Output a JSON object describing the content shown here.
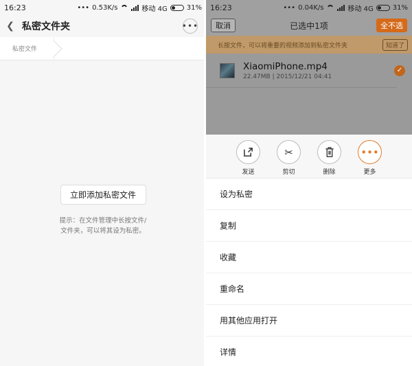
{
  "left": {
    "status": {
      "time": "16:23",
      "speed": "0.53K/s",
      "carrier": "移动 4G",
      "battery": "31%"
    },
    "header": {
      "title": "私密文件夹"
    },
    "breadcrumb": "私密文件",
    "add_button": "立即添加私密文件",
    "hint_line1": "提示：在文件管理中长按文件/",
    "hint_line2": "文件夹，可以将其设为私密。"
  },
  "right": {
    "status": {
      "time": "16:23",
      "speed": "0.04K/s",
      "carrier": "移动 4G",
      "battery": "31%"
    },
    "header": {
      "cancel": "取消",
      "title": "已选中1项",
      "deselect_all": "全不选"
    },
    "banner": {
      "text": "长按文件，可以将重要的视频添加到私密文件夹",
      "ok": "知道了"
    },
    "file": {
      "name": "XiaomiPhone.mp4",
      "size": "22.47MB",
      "date": "2015/12/21 04:41"
    },
    "actions": [
      {
        "label": "发送",
        "icon": "share-icon"
      },
      {
        "label": "剪切",
        "icon": "scissors-icon"
      },
      {
        "label": "删除",
        "icon": "trash-icon"
      },
      {
        "label": "更多",
        "icon": "more-icon"
      }
    ],
    "menu": [
      "设为私密",
      "复制",
      "收藏",
      "重命名",
      "用其他应用打开",
      "详情"
    ],
    "colors": {
      "accent": "#e07a2a",
      "check": "#c2661c"
    }
  }
}
